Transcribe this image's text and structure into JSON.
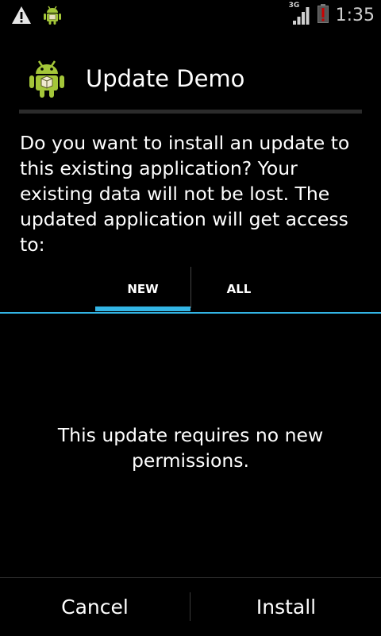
{
  "status_bar": {
    "notifications": [
      {
        "icon": "warning-icon"
      },
      {
        "icon": "android-app-icon"
      }
    ],
    "network_type": "3G",
    "time": "1:35"
  },
  "dialog": {
    "app_icon": "android-app-icon",
    "title": "Update Demo",
    "message": "Do you want to install an update to this existing application? Your existing data will not be lost. The updated application will get access to:"
  },
  "tabs": [
    {
      "label": "NEW",
      "selected": true
    },
    {
      "label": "ALL",
      "selected": false
    }
  ],
  "permissions_message": "This update requires no new permissions.",
  "buttons": {
    "cancel": "Cancel",
    "install": "Install"
  },
  "colors": {
    "accent": "#33b5e5",
    "android_green": "#a4c639",
    "background": "#000000",
    "battery_low": "#cc0000"
  }
}
